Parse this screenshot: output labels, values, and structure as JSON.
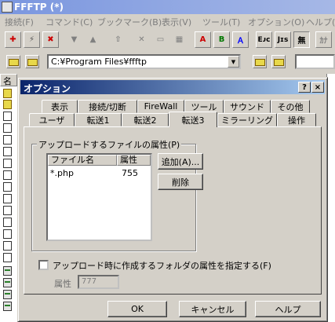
{
  "app": {
    "title": "FFFTP (*)",
    "menu": [
      "接続(F)",
      "コマンド(C)",
      "ブックマーク(B)",
      "表示(V)",
      "ツール(T)",
      "オプション(O)",
      "ヘルプ(H)"
    ],
    "path": "C:¥Program Files¥ffftp",
    "left_column_header": "名",
    "toolbar_labels": {
      "ascii": "A",
      "binary": "B",
      "none": "無",
      "euc": "Eᴊᴄ",
      "jis": "Jɪs",
      "kana": "ｶﾅ"
    }
  },
  "dialog": {
    "title": "オプション",
    "help_btn": "?",
    "close_btn": "×",
    "tabs_row1": [
      "表示",
      "接続/切断",
      "FireWall",
      "ツール",
      "サウンド",
      "その他"
    ],
    "tabs_row2": [
      "ユーザ",
      "転送1",
      "転送2",
      "転送3",
      "ミラーリング",
      "操作"
    ],
    "active_tab": "転送3",
    "group_label": "アップロードするファイルの属性(P)",
    "list": {
      "columns": [
        "ファイル名",
        "属性"
      ],
      "rows": [
        {
          "name": "*.php",
          "attr": "755"
        }
      ]
    },
    "add_button": "追加(A)...",
    "delete_button": "削除",
    "checkbox_label": "アップロード時に作成するフォルダの属性を指定する(F)",
    "checkbox_checked": false,
    "attr_label": "属性",
    "attr_value": "777",
    "ok": "OK",
    "cancel": "キャンセル",
    "help": "ヘルプ"
  }
}
